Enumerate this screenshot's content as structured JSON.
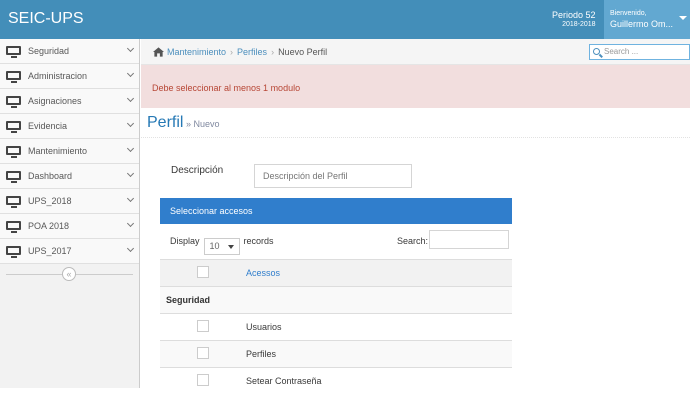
{
  "navbar": {
    "brand": "SEIC-UPS",
    "periodo_label": "Periodo 52",
    "periodo_years": "2018-2018",
    "welcome": "Bienvenido,",
    "user_name": "Guillermo Om..."
  },
  "sidebar": {
    "items": [
      {
        "label": "Seguridad"
      },
      {
        "label": "Administracion"
      },
      {
        "label": "Asignaciones"
      },
      {
        "label": "Evidencia"
      },
      {
        "label": "Mantenimiento"
      },
      {
        "label": "Dashboard"
      },
      {
        "label": "UPS_2018"
      },
      {
        "label": "POA 2018"
      },
      {
        "label": "UPS_2017"
      }
    ],
    "collapse_glyph": "«"
  },
  "breadcrumb": {
    "items": [
      "Mantenimiento",
      "Perfiles"
    ],
    "current": "Nuevo Perfil",
    "separator": "›",
    "search_placeholder": "Search ..."
  },
  "alert": {
    "message": "Debe seleccionar al menos 1 modulo"
  },
  "page_header": {
    "title": "Perfil",
    "subtitle": "» Nuevo"
  },
  "form": {
    "description_label": "Descripción",
    "description_placeholder": "Descripción del Perfil"
  },
  "access_panel": {
    "title": "Seleccionar accesos",
    "display_label": "Display",
    "display_value": "10",
    "records_label": "records",
    "search_label": "Search:",
    "column_header": "Acessos",
    "group": "Seguridad",
    "rows": [
      {
        "label": "Usuarios"
      },
      {
        "label": "Perfiles"
      },
      {
        "label": "Setear Contraseña"
      }
    ]
  }
}
